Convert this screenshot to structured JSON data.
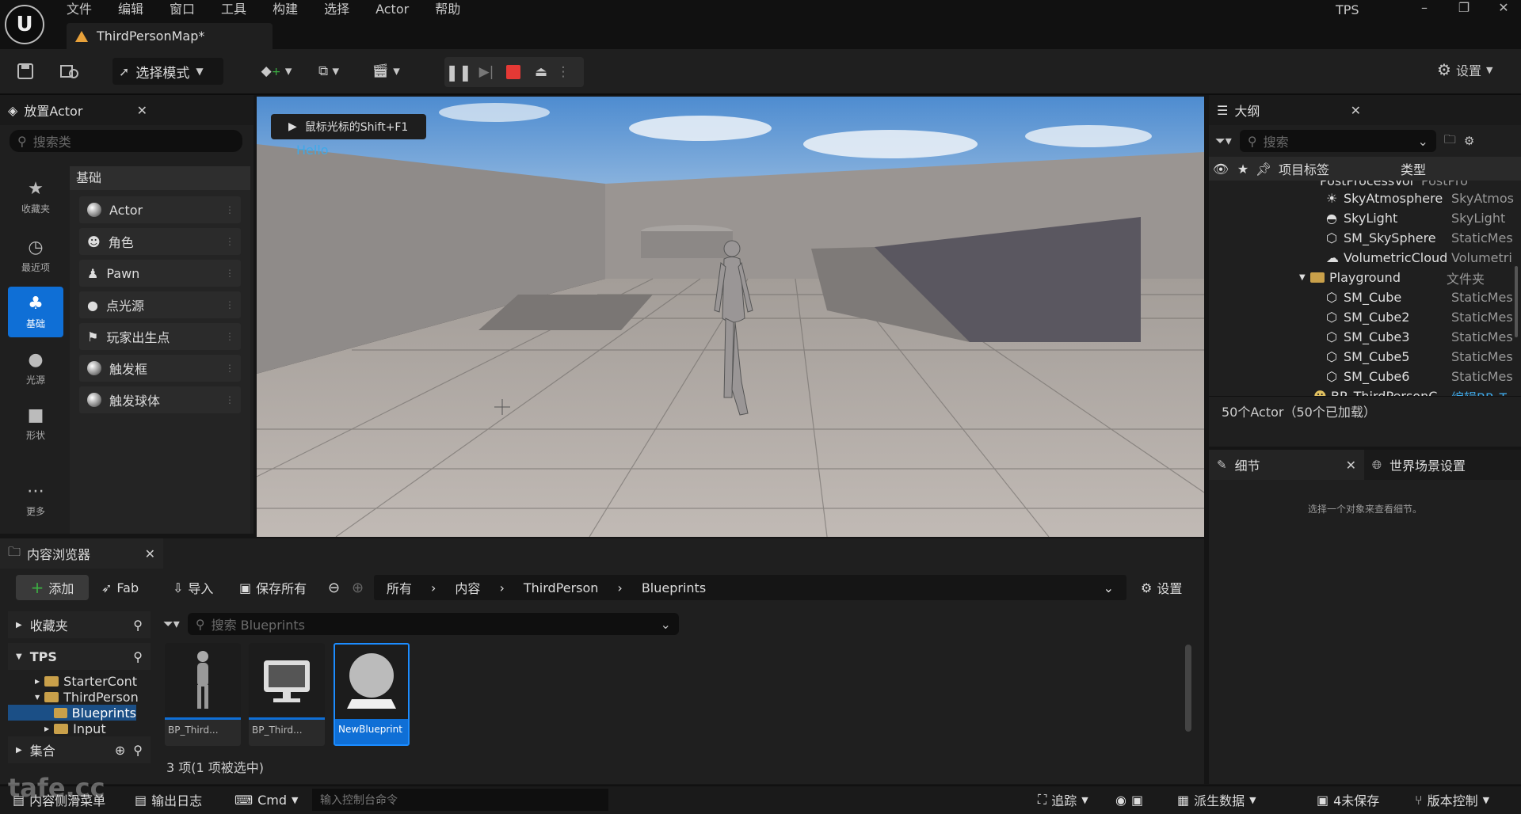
{
  "menu": [
    "文件",
    "编辑",
    "窗口",
    "工具",
    "构建",
    "选择",
    "Actor",
    "帮助"
  ],
  "project_name": "TPS",
  "window_controls": [
    "–",
    "❐",
    "✕"
  ],
  "map_tab": "ThirdPersonMap*",
  "toolbar": {
    "mode_label": "选择模式",
    "settings_label": "设置"
  },
  "place_actors": {
    "title": "放置Actor",
    "search_placeholder": "搜索类",
    "categories": [
      {
        "label": "收藏夹",
        "icon": "star-icon"
      },
      {
        "label": "最近项",
        "icon": "clock-icon"
      },
      {
        "label": "基础",
        "icon": "shapes-icon"
      },
      {
        "label": "光源",
        "icon": "lightbulb-icon"
      },
      {
        "label": "形状",
        "icon": "cube-icon"
      },
      {
        "label": "更多",
        "icon": "more-icon"
      }
    ],
    "section_title": "基础",
    "items": [
      "Actor",
      "角色",
      "Pawn",
      "点光源",
      "玩家出生点",
      "触发框",
      "触发球体"
    ]
  },
  "viewport": {
    "hint": "鼠标光标的Shift+F1",
    "hello_text": "Hello"
  },
  "outliner": {
    "title": "大纲",
    "search_placeholder": "搜索",
    "col_label": "项目标签",
    "col_type": "类型",
    "partial_row": {
      "name": "PostProcessVol",
      "type": "PostPro"
    },
    "rows": [
      {
        "name": "SkyAtmosphere",
        "type": "SkyAtmos"
      },
      {
        "name": "SkyLight",
        "type": "SkyLight"
      },
      {
        "name": "SM_SkySphere",
        "type": "StaticMes"
      },
      {
        "name": "VolumetricCloud",
        "type": "Volumetri"
      },
      {
        "name": "Playground",
        "type": "文件夹"
      },
      {
        "name": "SM_Cube",
        "type": "StaticMes"
      },
      {
        "name": "SM_Cube2",
        "type": "StaticMes"
      },
      {
        "name": "SM_Cube3",
        "type": "StaticMes"
      },
      {
        "name": "SM_Cube5",
        "type": "StaticMes"
      },
      {
        "name": "SM_Cube6",
        "type": "StaticMes"
      },
      {
        "name": "BP_ThirdPersonC",
        "type": "编辑BP_T"
      }
    ],
    "count_text": "50个Actor（50个已加载）"
  },
  "details": {
    "tab1": "细节",
    "tab2": "世界场景设置",
    "empty_text": "选择一个对象来查看细节。"
  },
  "content_browser": {
    "title": "内容浏览器",
    "add_label": "添加",
    "fab_label": "Fab",
    "import_label": "导入",
    "save_all_label": "保存所有",
    "breadcrumb": [
      "所有",
      "内容",
      "ThirdPerson",
      "Blueprints"
    ],
    "settings_label": "设置",
    "favorites_label": "收藏夹",
    "tree_root": "TPS",
    "tree": [
      "StarterCont",
      "ThirdPerson",
      "Blueprints",
      "Input"
    ],
    "collections_label": "集合",
    "search_placeholder": "搜索 Blueprints",
    "assets": [
      "BP_Third...",
      "BP_Third...",
      "NewBlueprint"
    ],
    "status": "3 项(1 项被选中)"
  },
  "statusbar": {
    "drawer": "内容侧滑菜单",
    "output_log": "输出日志",
    "cmd": "Cmd",
    "console_placeholder": "输入控制台命令",
    "trace": "追踪",
    "derived_data": "派生数据",
    "unsaved": "4未保存",
    "source_control": "版本控制"
  },
  "watermark": "tafe.cc",
  "colors": {
    "accent": "#0f6fd6",
    "stop": "#e53935",
    "folder": "#c9a04a",
    "hello": "#3fa9e8"
  }
}
